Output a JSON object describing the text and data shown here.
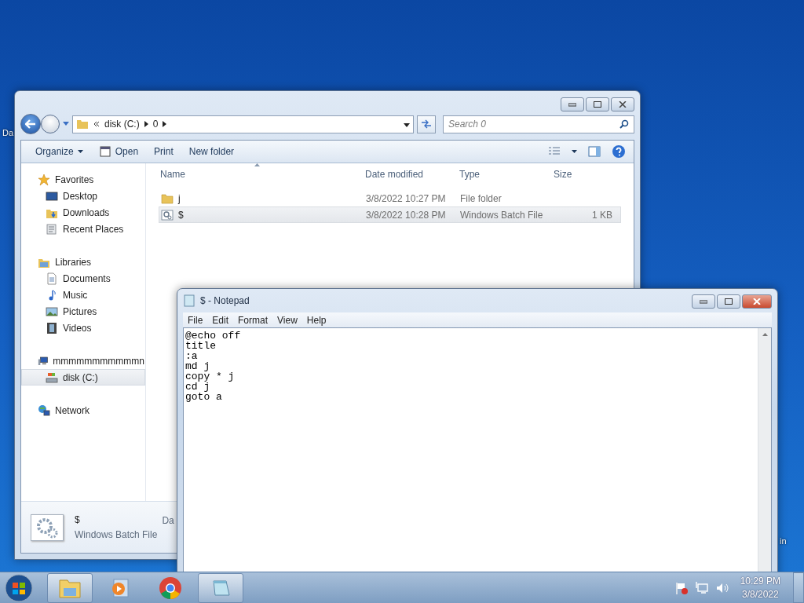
{
  "desktop": {
    "icon_labels": [
      "Da",
      "in"
    ]
  },
  "explorer": {
    "breadcrumb": [
      "disk (C:)",
      "0"
    ],
    "search": {
      "placeholder": "Search 0"
    },
    "toolbar": [
      {
        "label": "Organize",
        "kind": "menu"
      },
      {
        "label": "Open",
        "kind": "open"
      },
      {
        "label": "Print",
        "kind": "plain"
      },
      {
        "label": "New folder",
        "kind": "plain"
      }
    ],
    "nav": [
      {
        "label": "Favorites",
        "kind": "star",
        "selected": false,
        "children": [
          {
            "label": "Desktop",
            "kind": "desktop",
            "selected": false
          },
          {
            "label": "Downloads",
            "kind": "downloads",
            "selected": false
          },
          {
            "label": "Recent Places",
            "kind": "recent",
            "selected": false
          }
        ]
      },
      {
        "label": "Libraries",
        "kind": "library",
        "selected": false,
        "children": [
          {
            "label": "Documents",
            "kind": "documents",
            "selected": false
          },
          {
            "label": "Music",
            "kind": "music",
            "selected": false
          },
          {
            "label": "Pictures",
            "kind": "pictures",
            "selected": false
          },
          {
            "label": "Videos",
            "kind": "videos",
            "selected": false
          }
        ]
      },
      {
        "label": "mmmmmmmmmmmn",
        "kind": "computer",
        "selected": false,
        "children": [
          {
            "label": "disk (C:)",
            "kind": "drive",
            "selected": true
          }
        ]
      },
      {
        "label": "Network",
        "kind": "network",
        "selected": false
      }
    ],
    "columns": [
      "Name",
      "Date modified",
      "Type",
      "Size"
    ],
    "rows": [
      {
        "name": "j",
        "date": "3/8/2022 10:27 PM",
        "type": "File folder",
        "kind": "folder",
        "selected": false
      },
      {
        "name": "$",
        "date": "3/8/2022 10:28 PM",
        "type": "Windows Batch File",
        "size": "1 KB",
        "kind": "batch",
        "selected": true
      }
    ],
    "details": {
      "name": "$",
      "type": "Windows Batch File",
      "extra": "Da"
    }
  },
  "notepad": {
    "title": "$ - Notepad",
    "menu": [
      "File",
      "Edit",
      "Format",
      "View",
      "Help"
    ],
    "lines": [
      "@echo off",
      "title",
      ":a",
      "md j",
      "copy * j",
      "cd j",
      "goto a"
    ]
  },
  "taskbar": {
    "apps": [
      {
        "kind": "explorer",
        "running": true
      },
      {
        "kind": "media",
        "running": false
      },
      {
        "kind": "chrome",
        "running": false
      },
      {
        "kind": "notepad",
        "running": true
      }
    ],
    "clock": {
      "time": "10:29 PM",
      "date": "3/8/2022"
    }
  }
}
